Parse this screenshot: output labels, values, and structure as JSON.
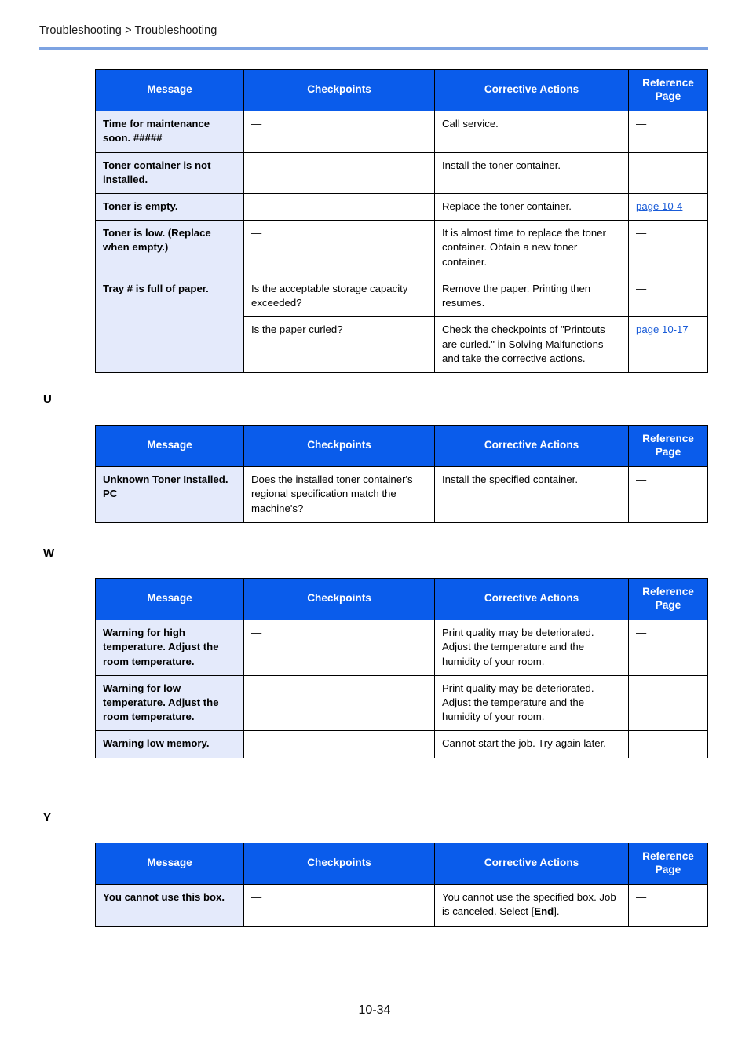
{
  "header": {
    "breadcrumb": "Troubleshooting > Troubleshooting"
  },
  "footer": {
    "page_number": "10-34"
  },
  "columns": {
    "message": "Message",
    "checkpoints": "Checkpoints",
    "corrective_actions": "Corrective Actions",
    "reference_page": "Reference Page"
  },
  "colors": {
    "header_blue": "#0a5ceb",
    "message_cell_bg": "#e4eafb",
    "rule_blue": "#7da3e2",
    "link_blue": "#1a5cd8"
  },
  "sections": [
    {
      "letter": "",
      "rows": [
        {
          "message": "Time for maintenance soon. #####",
          "checkpoints": "—",
          "corrective_actions": "Call service.",
          "reference_page": "—",
          "reference_is_link": false
        },
        {
          "message": "Toner container is not installed.",
          "checkpoints": "—",
          "corrective_actions": "Install the toner container.",
          "reference_page": "—",
          "reference_is_link": false
        },
        {
          "message": "Toner is empty.",
          "checkpoints": "—",
          "corrective_actions": "Replace the toner container.",
          "reference_page": "page 10-4",
          "reference_is_link": true
        },
        {
          "message": "Toner is low. (Replace when empty.)",
          "checkpoints": "—",
          "corrective_actions": "It is almost time to replace the toner container. Obtain a new toner container.",
          "reference_page": "—",
          "reference_is_link": false
        },
        {
          "message": "Tray # is full of paper.",
          "message_rowspan": 2,
          "checkpoints": "Is the acceptable storage capacity exceeded?",
          "corrective_actions": "Remove the paper. Printing then resumes.",
          "reference_page": "—",
          "reference_is_link": false
        },
        {
          "message": null,
          "checkpoints": "Is the paper curled?",
          "corrective_actions": "Check the checkpoints of \"Printouts are curled.\" in Solving Malfunctions and take the corrective actions.",
          "reference_page": "page 10-17",
          "reference_is_link": true
        }
      ]
    },
    {
      "letter": "U",
      "rows": [
        {
          "message": "Unknown Toner Installed. PC",
          "checkpoints": "Does the installed toner container's regional specification match the machine's?",
          "corrective_actions": "Install the specified container.",
          "reference_page": "—",
          "reference_is_link": false
        }
      ]
    },
    {
      "letter": "W",
      "rows": [
        {
          "message": "Warning for high temperature. Adjust the room temperature.",
          "checkpoints": "—",
          "corrective_actions": "Print quality may be deteriorated. Adjust the temperature and the humidity of your room.",
          "reference_page": "—",
          "reference_is_link": false
        },
        {
          "message": "Warning for low temperature. Adjust the room temperature.",
          "checkpoints": "—",
          "corrective_actions": "Print quality may be deteriorated. Adjust the temperature and the humidity of your room.",
          "reference_page": "—",
          "reference_is_link": false
        },
        {
          "message": "Warning low memory.",
          "checkpoints": "—",
          "corrective_actions": "Cannot start the job. Try again later.",
          "reference_page": "—",
          "reference_is_link": false
        }
      ]
    },
    {
      "letter": "Y",
      "rows": [
        {
          "message": "You cannot use this box.",
          "checkpoints": "—",
          "corrective_actions_parts": [
            {
              "text": "You cannot use the specified box. Job is canceled. Select [",
              "bold": false
            },
            {
              "text": "End",
              "bold": true
            },
            {
              "text": "].",
              "bold": false
            }
          ],
          "corrective_actions": "You cannot use the specified box. Job is canceled. Select [End].",
          "reference_page": "—",
          "reference_is_link": false
        }
      ]
    }
  ]
}
